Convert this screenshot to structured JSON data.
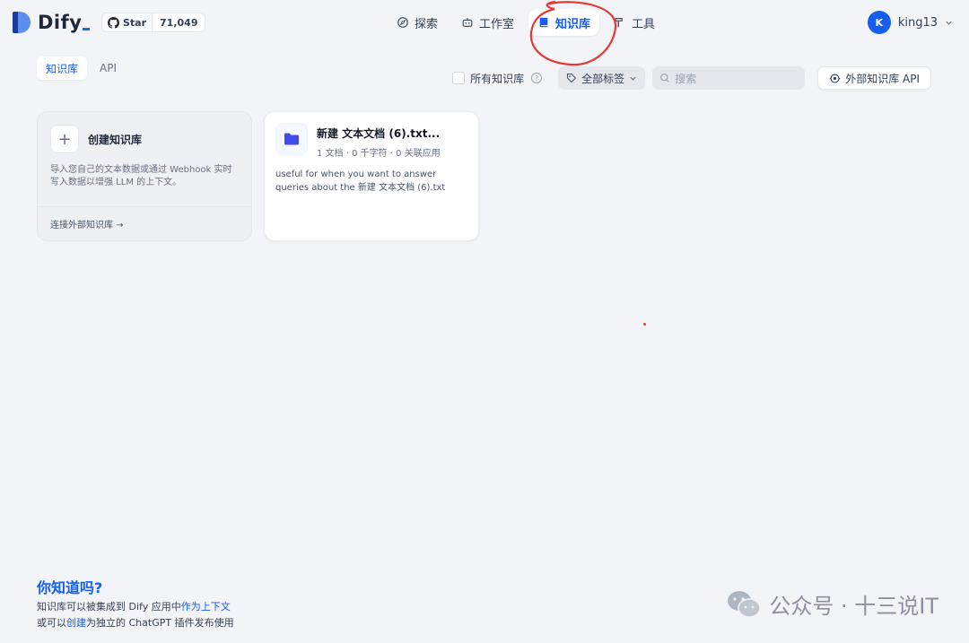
{
  "header": {
    "logo_text": "Dify",
    "github_star_label": "Star",
    "github_star_count": "71,049",
    "nav": [
      {
        "label": "探索",
        "icon": "explore-icon"
      },
      {
        "label": "工作室",
        "icon": "robot-icon"
      },
      {
        "label": "知识库",
        "icon": "book-icon",
        "active": true
      },
      {
        "label": "工具",
        "icon": "hammer-icon"
      }
    ],
    "user": {
      "avatar_initial": "K",
      "name": "king13"
    }
  },
  "toolbar": {
    "tabs": [
      {
        "label": "知识库",
        "active": true
      },
      {
        "label": "API",
        "active": false
      }
    ],
    "all_datasets_label": "所有知识库",
    "tag_filter_label": "全部标签",
    "search_placeholder": "搜索",
    "external_api_label": "外部知识库 API"
  },
  "create_card": {
    "title": "创建知识库",
    "description": "导入您自己的文本数据或通过 Webhook 实时写入数据以增强 LLM 的上下文。",
    "connect_link": "连接外部知识库 →"
  },
  "datasets": [
    {
      "title": "新建 文本文档 (6).txt...",
      "meta": "1 文档 · 0 千字符 · 0 关联应用",
      "description": "useful for when you want to answer queries about the 新建 文本文档 (6).txt"
    }
  ],
  "tip": {
    "title": "你知道吗?",
    "line1_prefix": "知识库可以被集成到 Dify 应用中",
    "line1_link": "作为上下文",
    "line2_prefix": "或可以",
    "line2_link": "创建",
    "line2_suffix": "为独立的 ChatGPT 插件发布使用"
  },
  "watermark": {
    "text": "公众号 · 十三说IT"
  },
  "colors": {
    "accent": "#155eef",
    "background": "#f2f4f7",
    "annotation": "#e53935"
  }
}
